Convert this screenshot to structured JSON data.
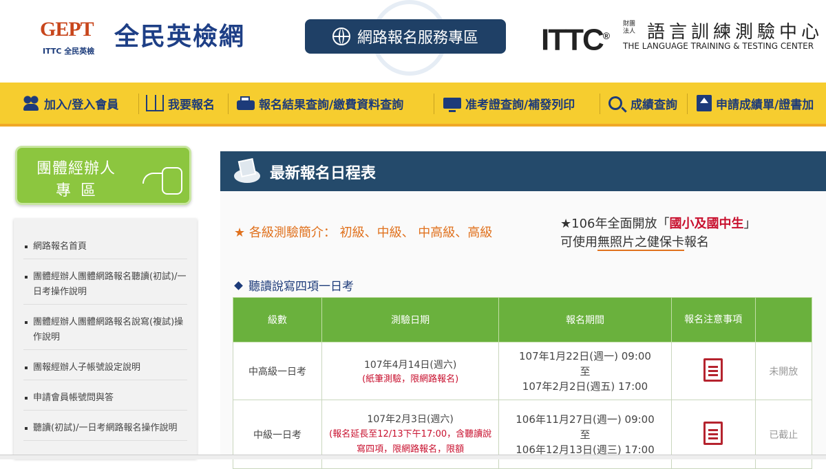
{
  "header": {
    "gept_mark": "GEPT",
    "gept_sub": "ITTC 全民英檢",
    "site_title": "全民英檢網",
    "service_button": "網路報名服務專區",
    "ittc_logo": "ITTC",
    "ittc_small": "財團法人",
    "ittc_cn": "語言訓練測驗中心",
    "ittc_en": "THE LANGUAGE TRAINING & TESTING CENTER"
  },
  "nav": {
    "items": [
      {
        "label": "加入/登入會員",
        "icon": "people-icon"
      },
      {
        "label": "我要報名",
        "icon": "book-icon"
      },
      {
        "label": "報名結果查詢/繳費資料查詢",
        "icon": "printer-icon"
      },
      {
        "label": "准考證查詢/補發列印",
        "icon": "monitor-icon"
      },
      {
        "label": "成績查詢",
        "icon": "search-icon"
      },
      {
        "label": "申請成績單/證書加",
        "icon": "upload-icon"
      }
    ]
  },
  "sidebar": {
    "group_button": {
      "line1": "團體經辦人",
      "line2": "專區"
    },
    "items": [
      {
        "label": "網路報名首頁"
      },
      {
        "label": "團體經辦人團體網路報名聽讀(初試)/一日考操作說明"
      },
      {
        "label": "團體經辦人團體網路報名說寫(複試)操作說明"
      },
      {
        "label": "團報經辦人子帳號設定說明"
      },
      {
        "label": "申請會員帳號問與答"
      },
      {
        "label": "聽讀(初試)/一日考網路報名操作說明"
      }
    ]
  },
  "main": {
    "banner_title": "最新報名日程表",
    "intro": "★ 各級測驗簡介： 初級、中級、 中高級、高級",
    "notice": {
      "pre": "★106年全面開放「",
      "highlight": "國小及國中生",
      "post": "」",
      "line2_pre": "可使用",
      "line2_underline": "無照片之健保卡",
      "line2_post": "報名"
    },
    "section_title": "聽讀說寫四項一日考",
    "table": {
      "headers": [
        "級數",
        "測驗日期",
        "報名期間",
        "報名注意事項",
        ""
      ],
      "rows": [
        {
          "level": "中高級一日考",
          "date": "107年4月14日(週六)",
          "date_note": "(紙筆測驗，限網路報名)",
          "period_start": "107年1月22日(週一) 09:00",
          "period_mid": "至",
          "period_end": "107年2月2日(週五) 17:00",
          "status": "未開放"
        },
        {
          "level": "中級一日考",
          "date": "107年2月3日(週六)",
          "date_note": "(報名延長至12/13下午17:00，含聽讀說寫四項，限網路報名，限額",
          "period_start": "106年11月27日(週一) 09:00",
          "period_mid": "至",
          "period_end": "106年12月13日(週三) 17:00",
          "status": "已截止"
        }
      ]
    }
  }
}
